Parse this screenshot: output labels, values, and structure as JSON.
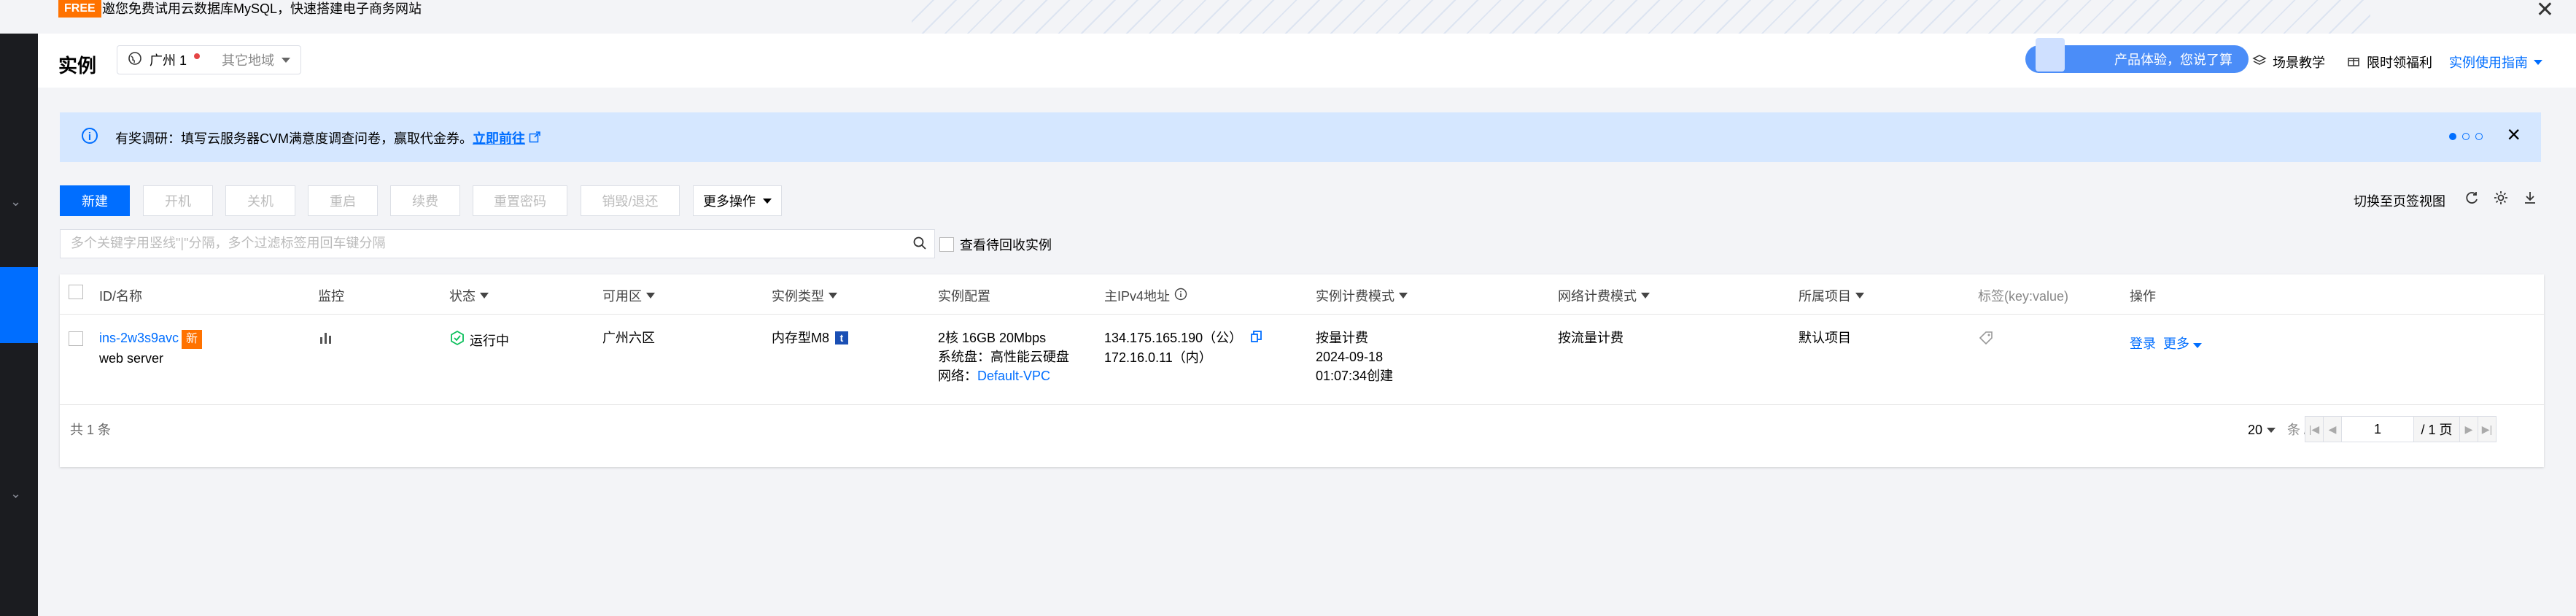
{
  "promo": {
    "badge": "FREE",
    "text": "邀您免费试用云数据库MySQL，快速搭建电子商务网站"
  },
  "header": {
    "title": "实例",
    "region": "广州 1",
    "other_region": "其它地域",
    "experience_pill": "产品体验，您说了算",
    "scene_tutorial": "场景教学",
    "limited_offer": "限时领福利",
    "guide": "实例使用指南"
  },
  "banner": {
    "message": "有奖调研：填写云服务器CVM满意度调查问卷，赢取代金券。",
    "link": "立即前往"
  },
  "toolbar": {
    "new": "新建",
    "start": "开机",
    "shutdown": "关机",
    "restart": "重启",
    "renew": "续费",
    "reset_password": "重置密码",
    "terminate": "销毁/退还",
    "more_actions": "更多操作",
    "switch_view": "切换至页签视图"
  },
  "search": {
    "placeholder": "多个关键字用竖线\"|\"分隔，多个过滤标签用回车键分隔",
    "recycle_label": "查看待回收实例"
  },
  "table": {
    "headers": {
      "id_name": "ID/名称",
      "monitor": "监控",
      "status": "状态",
      "zone": "可用区",
      "type": "实例类型",
      "config": "实例配置",
      "ipv4": "主IPv4地址",
      "billing": "实例计费模式",
      "net_billing": "网络计费模式",
      "project": "所属项目",
      "tags": "标签(key:value)",
      "ops": "操作"
    },
    "row": {
      "id": "ins-2w3s9avc",
      "new_badge": "新",
      "name": "web server",
      "status": "运行中",
      "zone": "广州六区",
      "type": "内存型M8",
      "config_line1": "2核 16GB 20Mbps",
      "config_line2": "系统盘：高性能云硬盘",
      "config_line3_label": "网络：",
      "config_line3_vpc": "Default-VPC",
      "ip_public": "134.175.165.190（公）",
      "ip_private": "172.16.0.11（内）",
      "billing_mode": "按量计费",
      "billing_date": "2024-09-18",
      "billing_created": "01:07:34创建",
      "net_billing": "按流量计费",
      "project": "默认项目",
      "op_login": "登录",
      "op_more": "更多"
    },
    "footer": {
      "total": "共 1 条",
      "page_size": "20",
      "per_page": "条 / 页",
      "page": "1",
      "total_pages": "/ 1 页"
    }
  },
  "colors": {
    "accent": "#006eff",
    "badge": "#ff7200",
    "rail": "#1b1c20",
    "banner_bg": "#d5e7ff",
    "status_green": "#0abf5b"
  }
}
